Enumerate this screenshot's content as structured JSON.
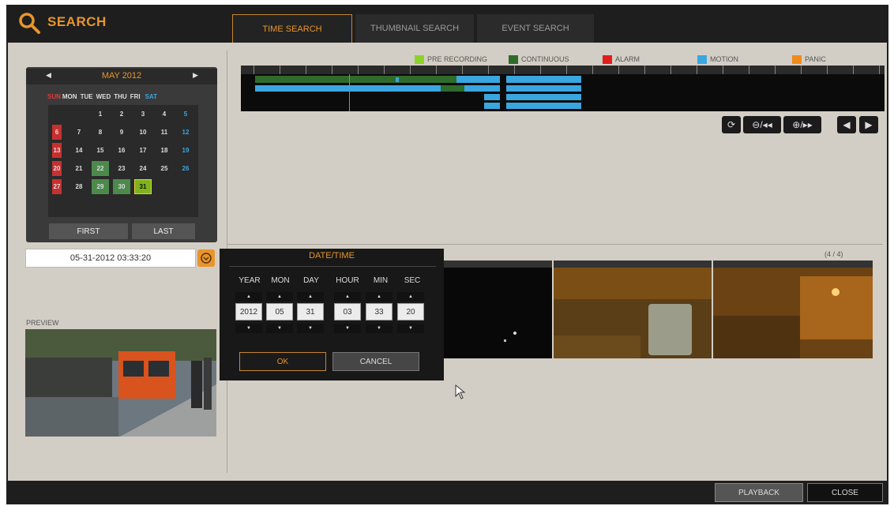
{
  "app": {
    "title": "SEARCH",
    "icon": "search-icon"
  },
  "tabs": [
    {
      "label": "TIME SEARCH",
      "active": true
    },
    {
      "label": "THUMBNAIL SEARCH",
      "active": false
    },
    {
      "label": "EVENT SEARCH",
      "active": false
    }
  ],
  "legend": [
    {
      "label": "PRE RECORDING",
      "color": "#8dd12b"
    },
    {
      "label": "CONTINUOUS",
      "color": "#2f6b2a"
    },
    {
      "label": "ALARM",
      "color": "#e01e1e"
    },
    {
      "label": "MOTION",
      "color": "#3aa6e0"
    },
    {
      "label": "PANIC",
      "color": "#f08a1d"
    }
  ],
  "calendar": {
    "month_label": "MAY 2012",
    "weekdays": [
      "SUN",
      "MON",
      "TUE",
      "WED",
      "THU",
      "FRI",
      "SAT"
    ],
    "first_button": "FIRST",
    "last_button": "LAST",
    "days_with_data": [
      22,
      29,
      30
    ],
    "selected_day": 31
  },
  "date_field": {
    "value": "05-31-2012 03:33:20"
  },
  "preview": {
    "label": "PREVIEW"
  },
  "datetime_popup": {
    "title": "DATE/TIME",
    "fields": [
      {
        "label": "YEAR",
        "value": "2012"
      },
      {
        "label": "MON",
        "value": "05"
      },
      {
        "label": "DAY",
        "value": "31"
      },
      {
        "label": "HOUR",
        "value": "03"
      },
      {
        "label": "MIN",
        "value": "33"
      },
      {
        "label": "SEC",
        "value": "20"
      }
    ],
    "ok": "OK",
    "cancel": "CANCEL"
  },
  "thumbnails": {
    "page_indicator": "(4 / 4)"
  },
  "footer": {
    "playback": "PLAYBACK",
    "close": "CLOSE"
  }
}
